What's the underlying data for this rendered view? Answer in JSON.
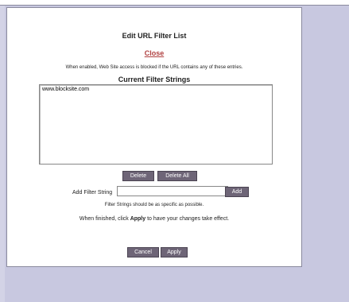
{
  "header": {
    "title": "Edit URL Filter List",
    "close_label": "Close"
  },
  "description": "When enabled, Web Site access is blocked if the URL contains any of these entries.",
  "filters": {
    "heading": "Current Filter Strings",
    "items": [
      "www.blocksite.com"
    ],
    "delete_label": "Delete",
    "delete_all_label": "Delete All"
  },
  "add": {
    "label": "Add Filter String",
    "value": "",
    "button_label": "Add"
  },
  "hint": "Filter Strings should be as specific as possible.",
  "finish": {
    "prefix": "When finished, click ",
    "emphasis": "Apply",
    "suffix": " to have your changes take effect."
  },
  "actions": {
    "cancel_label": "Cancel",
    "apply_label": "Apply"
  },
  "colors": {
    "button_bg": "#6e6577",
    "close_link": "#b04040",
    "background": "#c8c8e0"
  }
}
